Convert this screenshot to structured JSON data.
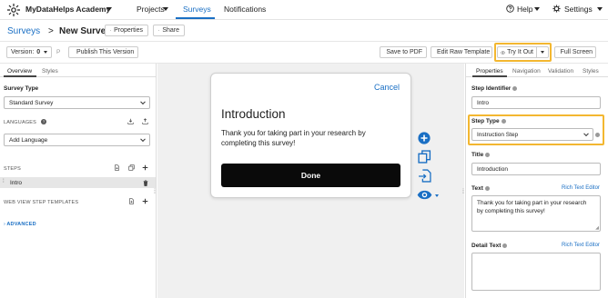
{
  "brand": {
    "name": "MyDataHelps Academy"
  },
  "nav": {
    "projects": "Projects",
    "surveys": "Surveys",
    "notifications": "Notifications",
    "help": "Help",
    "settings": "Settings"
  },
  "breadcrumb": {
    "parent": "Surveys",
    "separator": ">",
    "current": "New Survey"
  },
  "header_buttons": {
    "properties": "Properties",
    "share": "Share"
  },
  "toolbar": {
    "version_label": "Version:",
    "version_value": "0",
    "version_flag": "P",
    "publish": "Publish This Version",
    "save_pdf": "Save to PDF",
    "edit_raw": "Edit Raw Template",
    "try_it_out": "Try It Out",
    "full_screen": "Full Screen"
  },
  "left": {
    "tabs": [
      "Overview",
      "Styles"
    ],
    "survey_type_label": "Survey Type",
    "survey_type_value": "Standard Survey",
    "languages_label": "LANGUAGES",
    "add_language": "Add Language",
    "steps_label": "STEPS",
    "steps": [
      "Intro"
    ],
    "web_view_label": "WEB VIEW STEP TEMPLATES",
    "advanced": "ADVANCED"
  },
  "preview": {
    "cancel": "Cancel",
    "title": "Introduction",
    "body": "Thank you for taking part in your research by completing this survey!",
    "done": "Done"
  },
  "right": {
    "tabs": [
      "Properties",
      "Navigation",
      "Validation",
      "Styles"
    ],
    "step_identifier_label": "Step Identifier",
    "step_identifier_value": "Intro",
    "step_type_label": "Step Type",
    "step_type_value": "Instruction Step",
    "title_label": "Title",
    "title_value": "Introduction",
    "text_label": "Text",
    "text_value": "Thank you for taking part in your research by completing this survey!",
    "rich_text_editor": "Rich Text Editor",
    "detail_text_label": "Detail Text",
    "detail_rich_text_editor": "Rich Text Editor"
  },
  "colors": {
    "accent": "#1a6fc4",
    "highlight": "#f3b730",
    "done_button": "#0a0a0a"
  }
}
